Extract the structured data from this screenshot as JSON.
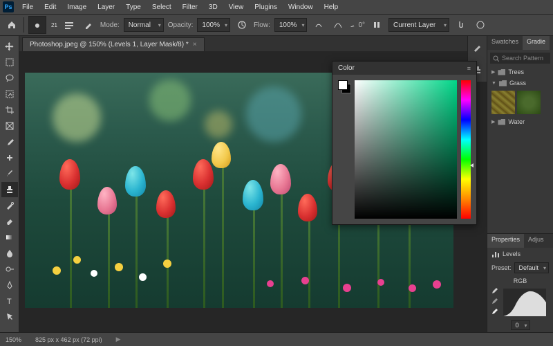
{
  "menu": [
    "File",
    "Edit",
    "Image",
    "Layer",
    "Type",
    "Select",
    "Filter",
    "3D",
    "View",
    "Plugins",
    "Window",
    "Help"
  ],
  "options": {
    "brush_size": "21",
    "mode_label": "Normal",
    "opacity_label": "Opacity:",
    "opacity_value": "100%",
    "flow_label": "Flow:",
    "flow_value": "100%",
    "angle": "0°",
    "layer_sel": "Current Layer"
  },
  "document": {
    "tab_title": "Photoshop.jpeg @ 150% (Levels 1, Layer Mask/8) *"
  },
  "colorpanel": {
    "title": "Color"
  },
  "patterns": {
    "tabs": [
      "Swatches",
      "Gradie"
    ],
    "search_placeholder": "Search Pattern",
    "groups": [
      {
        "name": "Trees",
        "open": false
      },
      {
        "name": "Grass",
        "open": true
      },
      {
        "name": "Water",
        "open": false
      }
    ]
  },
  "properties": {
    "tabs": [
      "Properties",
      "Adjus"
    ],
    "type": "Levels",
    "preset_label": "Preset:",
    "preset_value": "Default",
    "channel": "RGB",
    "shadow": "0"
  },
  "status": {
    "zoom": "150%",
    "dims": "825 px x 462 px (72 ppi)"
  }
}
